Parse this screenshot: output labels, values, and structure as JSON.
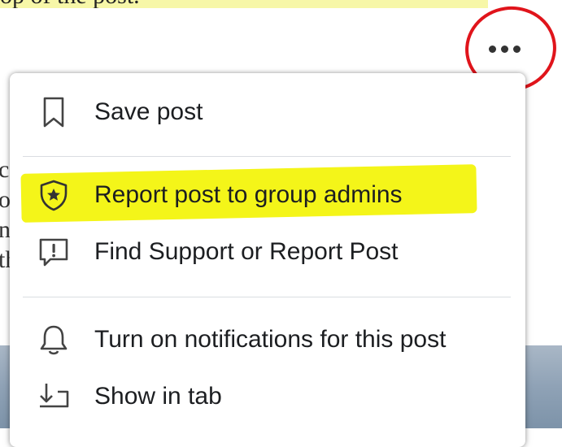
{
  "top_caption": "op of the post.",
  "background_fragments": [
    "c",
    "o",
    "n",
    "th"
  ],
  "more_button": {
    "icon": "more-horizontal-icon"
  },
  "menu": {
    "items": [
      {
        "id": "save",
        "label": "Save post",
        "icon": "bookmark-icon"
      },
      {
        "id": "report-admins",
        "label": "Report post to group admins",
        "icon": "shield-star-icon",
        "highlighted": true
      },
      {
        "id": "find-support",
        "label": "Find Support or Report Post",
        "icon": "report-alert-icon"
      },
      {
        "id": "notifications",
        "label": "Turn on notifications for this post",
        "icon": "bell-icon"
      },
      {
        "id": "show-tab",
        "label": "Show in tab",
        "icon": "arrow-in-tab-icon"
      }
    ]
  },
  "colors": {
    "highlight": "#f4f519",
    "annotation": "#e0141b"
  }
}
